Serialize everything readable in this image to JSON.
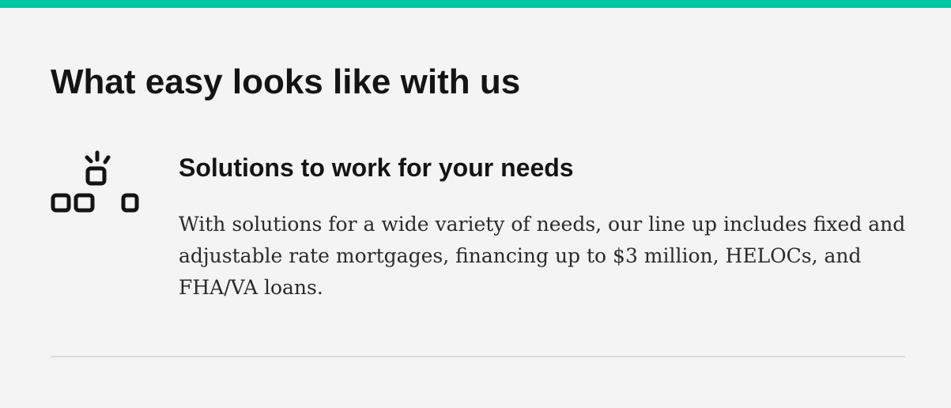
{
  "theme": {
    "accent": "#00c6a1",
    "divider": "#d9d9d9",
    "text": "#141414"
  },
  "section": {
    "title": "What easy looks like with us"
  },
  "feature": {
    "icon": "lightbulb-blocks-icon",
    "title": "Solutions to work for your needs",
    "description": "With solutions for a wide variety of needs, our line up includes fixed and adjustable rate mortgages, financing up to $3 million, HELOCs, and FHA/VA loans."
  }
}
